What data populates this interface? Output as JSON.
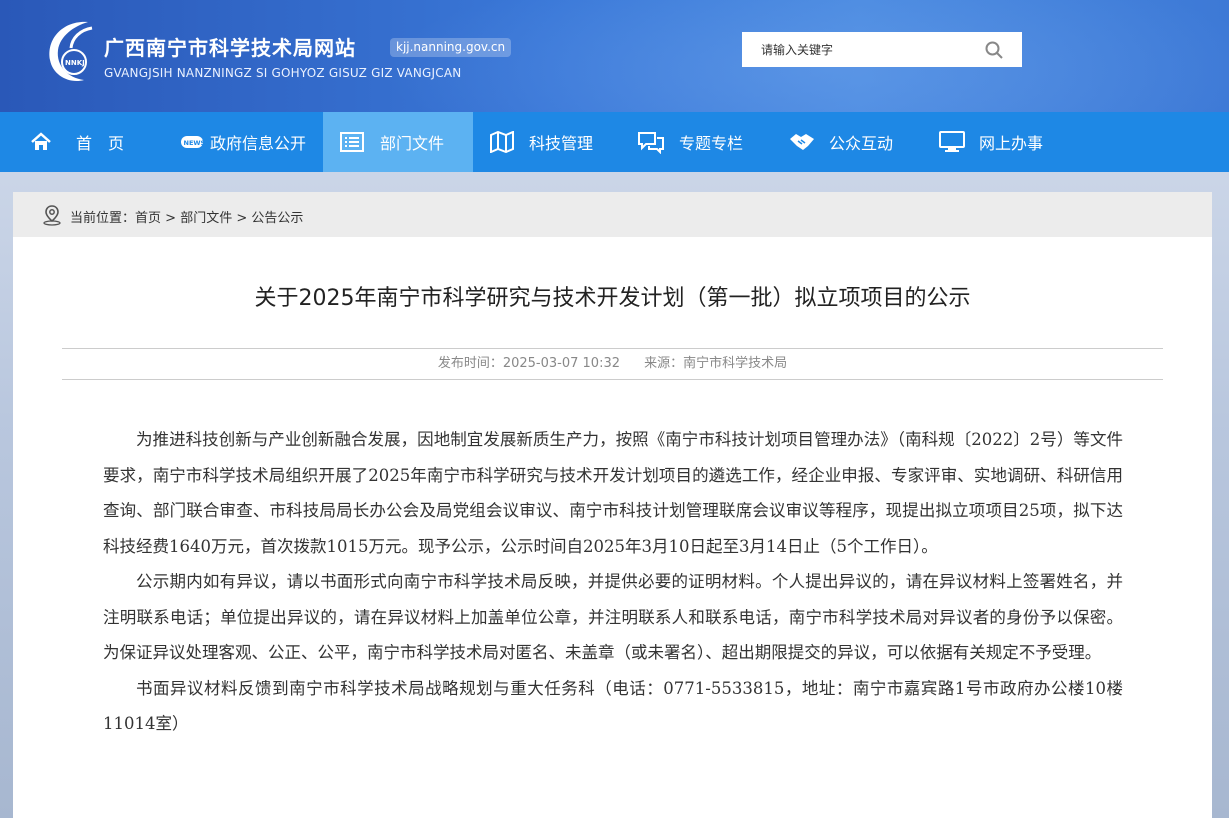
{
  "header": {
    "site_title": "广西南宁市科学技术局网站",
    "domain_badge": "kjj.nanning.gov.cn",
    "subtitle": "GVANGJSIH NANZNINGZ SI GOHYOZ GISUZ GIZ VANGJCAN",
    "logo_text": "NNKJ",
    "search_placeholder": "请输入关键字"
  },
  "nav": {
    "items": [
      {
        "label": "首　页",
        "icon": "home-icon"
      },
      {
        "label": "政府信息公开",
        "icon": "news-icon"
      },
      {
        "label": "部门文件",
        "icon": "document-list-icon",
        "active": true
      },
      {
        "label": "科技管理",
        "icon": "map-icon"
      },
      {
        "label": "专题专栏",
        "icon": "chat-icon"
      },
      {
        "label": "公众互动",
        "icon": "handshake-icon"
      },
      {
        "label": "网上办事",
        "icon": "monitor-icon"
      }
    ]
  },
  "breadcrumb": {
    "prefix": "当前位置：",
    "items": [
      "首页",
      "部门文件",
      "公告公示"
    ],
    "separator": " > "
  },
  "article": {
    "title": "关于2025年南宁市科学研究与技术开发计划（第一批）拟立项项目的公示",
    "publish_label": "发布时间：",
    "publish_time": "2025-03-07 10:32",
    "source_label": "来源：",
    "source": "南宁市科学技术局",
    "paragraphs": [
      "为推进科技创新与产业创新融合发展，因地制宜发展新质生产力，按照《南宁市科技计划项目管理办法》（南科规〔2022〕2号）等文件要求，南宁市科学技术局组织开展了2025年南宁市科学研究与技术开发计划项目的遴选工作，经企业申报、专家评审、实地调研、科研信用查询、部门联合审查、市科技局局长办公会及局党组会议审议、南宁市科技计划管理联席会议审议等程序，现提出拟立项项目25项，拟下达科技经费1640万元，首次拨款1015万元。现予公示，公示时间自2025年3月10日起至3月14日止（5个工作日）。",
      "公示期内如有异议，请以书面形式向南宁市科学技术局反映，并提供必要的证明材料。个人提出异议的，请在异议材料上签署姓名，并注明联系电话；单位提出异议的，请在异议材料上加盖单位公章，并注明联系人和联系电话，南宁市科学技术局对异议者的身份予以保密。为保证异议处理客观、公正、公平，南宁市科学技术局对匿名、未盖章（或未署名）、超出期限提交的异议，可以依据有关规定不予受理。",
      "书面异议材料反馈到南宁市科学技术局战略规划与重大任务科（电话：0771-5533815，地址：南宁市嘉宾路1号市政府办公楼10楼11014室）"
    ]
  },
  "colors": {
    "header_blue": "#2f64c7",
    "nav_blue": "#1e88e5",
    "nav_active": "#5cb2f2"
  }
}
